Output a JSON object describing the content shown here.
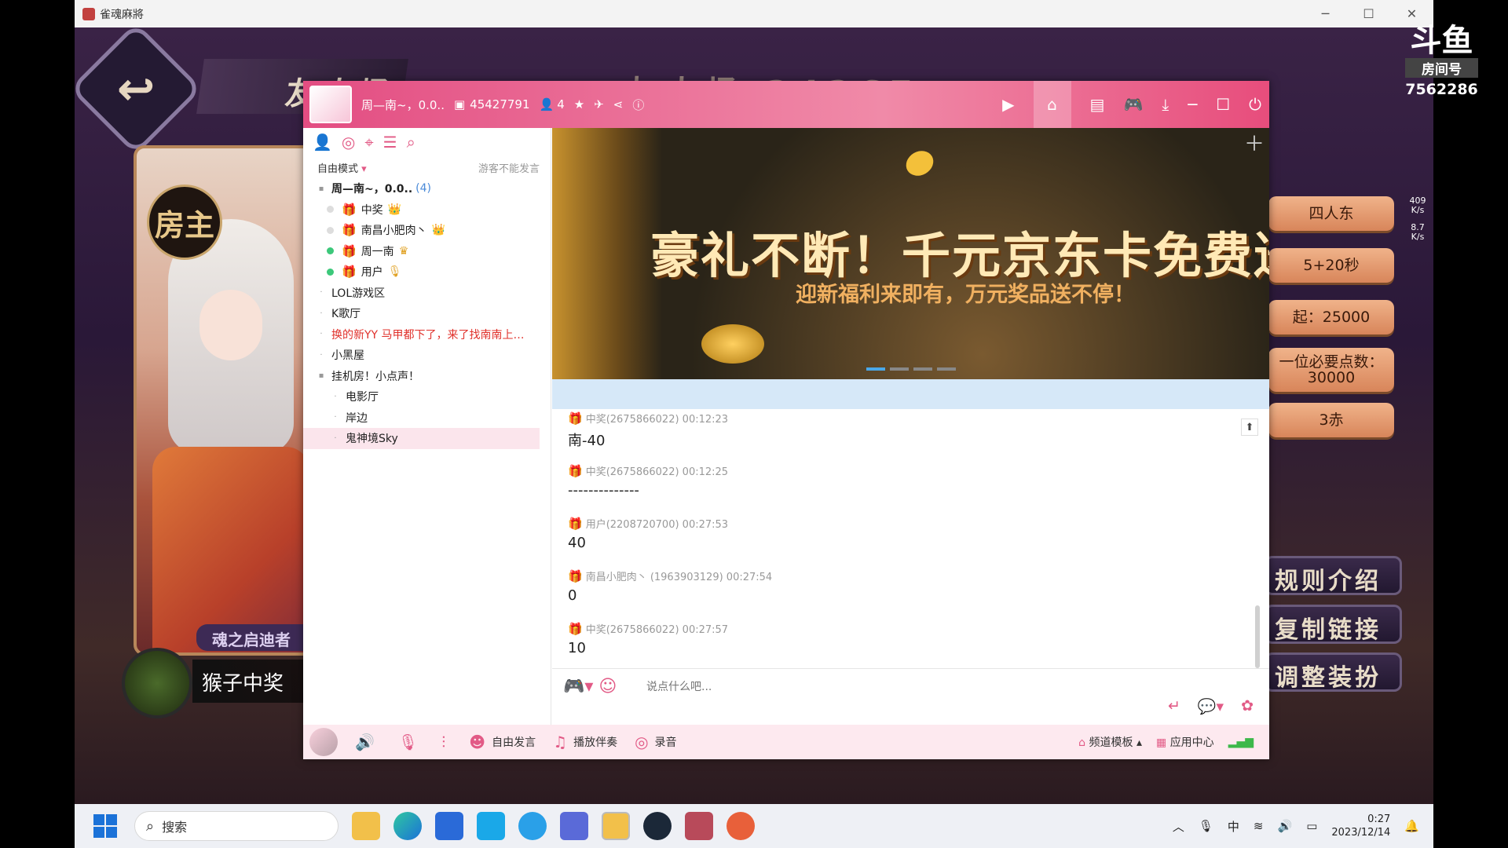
{
  "window": {
    "title": "雀魂麻將",
    "minimize": "─",
    "maximize": "☐",
    "close": "✕"
  },
  "game": {
    "back_label": "↩",
    "mode_title": "友人场",
    "host_badge": "房主",
    "soul_label": "魂之启迪者",
    "player_name": "猴子中奖",
    "room_title_bg": "友人场 24267",
    "rules": [
      "四人东",
      "5+20秒",
      "起：25000",
      "一位必要点数：30000",
      "3赤"
    ],
    "actions": [
      "规则介绍",
      "复制链接",
      "调整装扮"
    ],
    "stream": {
      "logo": "斗鱼",
      "label": "房间号",
      "number": "7562286",
      "net_up": "409",
      "net_unit": "K/s",
      "net_down": "8.7"
    }
  },
  "yy": {
    "header": {
      "channel": "周—南~，0.0..",
      "id": "45427791",
      "online": "4"
    },
    "left_mode": "自由模式",
    "guest_note": "游客不能发言",
    "tree": [
      {
        "label": "周—南~，0.0..",
        "count": "(4)",
        "level": 0,
        "kind": "root"
      },
      {
        "label": "中奖",
        "level": 1,
        "kind": "user",
        "dot": "#dddddd",
        "badge": "👑"
      },
      {
        "label": "南昌小肥肉丶",
        "level": 1,
        "kind": "user",
        "dot": "#dddddd",
        "badge": "👑"
      },
      {
        "label": "周一南",
        "level": 1,
        "kind": "user",
        "dot": "#3cc87a",
        "badge": "♛"
      },
      {
        "label": "用户",
        "level": 1,
        "kind": "user",
        "dot": "#3cc87a",
        "badge": "🎙"
      },
      {
        "label": "LOL游戏区",
        "level": 0,
        "kind": "ch"
      },
      {
        "label": "K歌厅",
        "level": 0,
        "kind": "ch"
      },
      {
        "label": "换的新YY  马甲都下了，来了找南南上…",
        "level": 0,
        "kind": "ch",
        "red": true
      },
      {
        "label": "小黑屋",
        "level": 0,
        "kind": "ch"
      },
      {
        "label": "挂机房！小点声！",
        "level": 0,
        "kind": "ch"
      },
      {
        "label": "电影厅",
        "level": 1,
        "kind": "ch"
      },
      {
        "label": "岸边",
        "level": 1,
        "kind": "ch"
      },
      {
        "label": "鬼神境Sky",
        "level": 1,
        "kind": "ch",
        "selected": true
      }
    ],
    "banner": {
      "title": "豪礼不断！千元京东卡免费送",
      "subtitle": "迎新福利来即有，万元奖品送不停！"
    },
    "messages": [
      {
        "meta": "中奖(2675866022)  00:12:23",
        "text": "南-40"
      },
      {
        "meta": "中奖(2675866022)  00:12:25",
        "text": "--------------"
      },
      {
        "meta": "用户(2208720700)  00:27:53",
        "text": "40"
      },
      {
        "meta": "南昌小肥肉丶 (1963903129)  00:27:54",
        "text": "0"
      },
      {
        "meta": "中奖(2675866022)  00:27:57",
        "text": "10"
      }
    ],
    "input_placeholder": "说点什么吧...",
    "bottom": {
      "free_speak": "自由发言",
      "accompany": "播放伴奏",
      "record": "录音",
      "template": "频道模板",
      "app_center": "应用中心"
    }
  },
  "taskbar": {
    "search": "搜索",
    "ime": "中",
    "time": "0:27",
    "date": "2023/12/14"
  }
}
